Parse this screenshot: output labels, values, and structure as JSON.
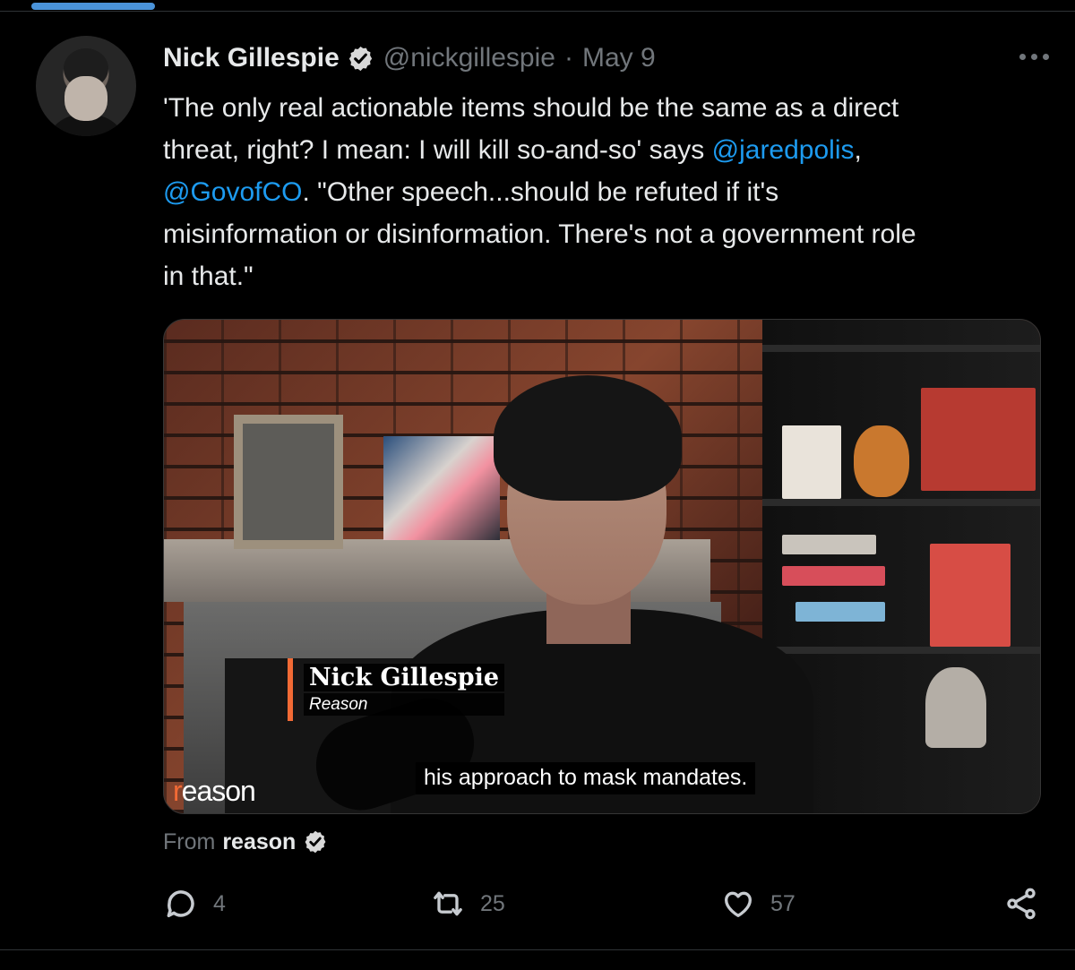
{
  "tweet": {
    "author_name": "Nick Gillespie",
    "author_handle": "@nickgillespie",
    "separator": "·",
    "date": "May 9",
    "text_lines": [
      "'The only real actionable items should be the same as a direct",
      "threat, right? I mean: I will kill so-and-so' says ",
      "@jaredpolis",
      ",",
      "@GovofCO",
      ". \"Other speech...should be refuted if it's",
      "misinformation or disinformation. There's not a government role",
      "in that.\""
    ],
    "media": {
      "caption_name": "Nick Gillespie",
      "caption_affiliation": "Reason",
      "subtitle": "his approach to mask mandates.",
      "watermark": "reason"
    },
    "from_label": "From",
    "from_source": "reason",
    "actions": {
      "replies": "4",
      "retweets": "25",
      "likes": "57"
    }
  },
  "colors": {
    "background": "#000000",
    "text": "#e7e9ea",
    "muted": "#71767b",
    "link": "#1d9bf0",
    "verified": "#d9d9d9",
    "reason_accent": "#f26a35"
  },
  "icons": {
    "verified": "verified-badge-icon",
    "more": "more-horizontal-icon",
    "reply": "reply-icon",
    "retweet": "retweet-icon",
    "like": "heart-icon",
    "share": "share-icon"
  }
}
